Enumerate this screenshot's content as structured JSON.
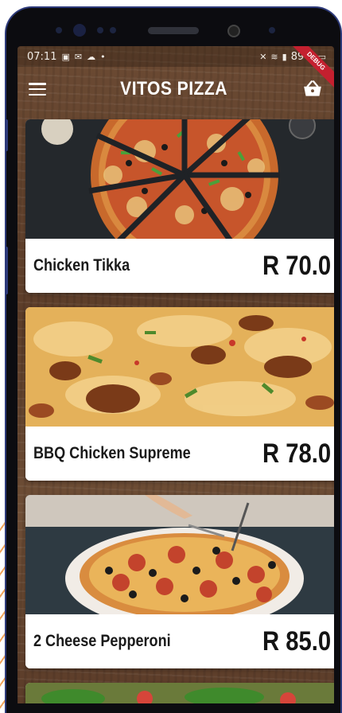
{
  "status_bar": {
    "time": "07:11",
    "battery": "89%"
  },
  "debug_ribbon": "DEBUG",
  "app_bar": {
    "title": "VITOS PIZZA"
  },
  "menu_items": [
    {
      "name": "Chicken Tikka",
      "price": "R 70.0"
    },
    {
      "name": "BBQ Chicken Supreme",
      "price": "R 78.0"
    },
    {
      "name": "2 Cheese Pepperoni",
      "price": "R 85.0"
    }
  ],
  "colors": {
    "phone_frame": "#2d3a7a",
    "wood_background": "#5c3d29",
    "debug_ribbon": "#c4202f",
    "card_text": "#1a1a1a"
  }
}
